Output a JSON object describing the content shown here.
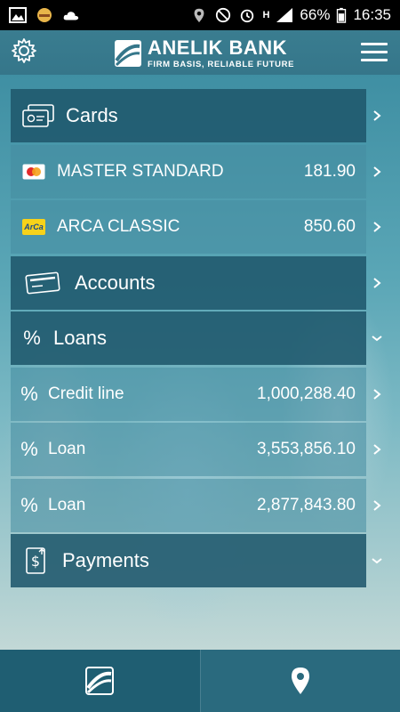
{
  "status_bar": {
    "battery": "66%",
    "time": "16:35",
    "network": "H"
  },
  "header": {
    "bank_name": "ANELIK BANK",
    "tagline": "FIRM BASIS, RELIABLE FUTURE"
  },
  "sections": {
    "cards": {
      "label": "Cards",
      "items": [
        {
          "label": "MASTER STANDARD",
          "amount": "181.90",
          "icon": "mastercard-icon"
        },
        {
          "label": "ARCA CLASSIC",
          "amount": "850.60",
          "icon": "arca-card-icon",
          "icon_text": "ArCa"
        }
      ]
    },
    "accounts": {
      "label": "Accounts"
    },
    "loans": {
      "label": "Loans",
      "pct_symbol": "%",
      "items": [
        {
          "label": "Credit line",
          "amount": "1,000,288.40"
        },
        {
          "label": "Loan",
          "amount": "3,553,856.10"
        },
        {
          "label": "Loan",
          "amount": "2,877,843.80"
        }
      ]
    },
    "payments": {
      "label": "Payments"
    }
  },
  "colors": {
    "section_bg": "#1f586c",
    "accent": "#2a6a7e"
  }
}
